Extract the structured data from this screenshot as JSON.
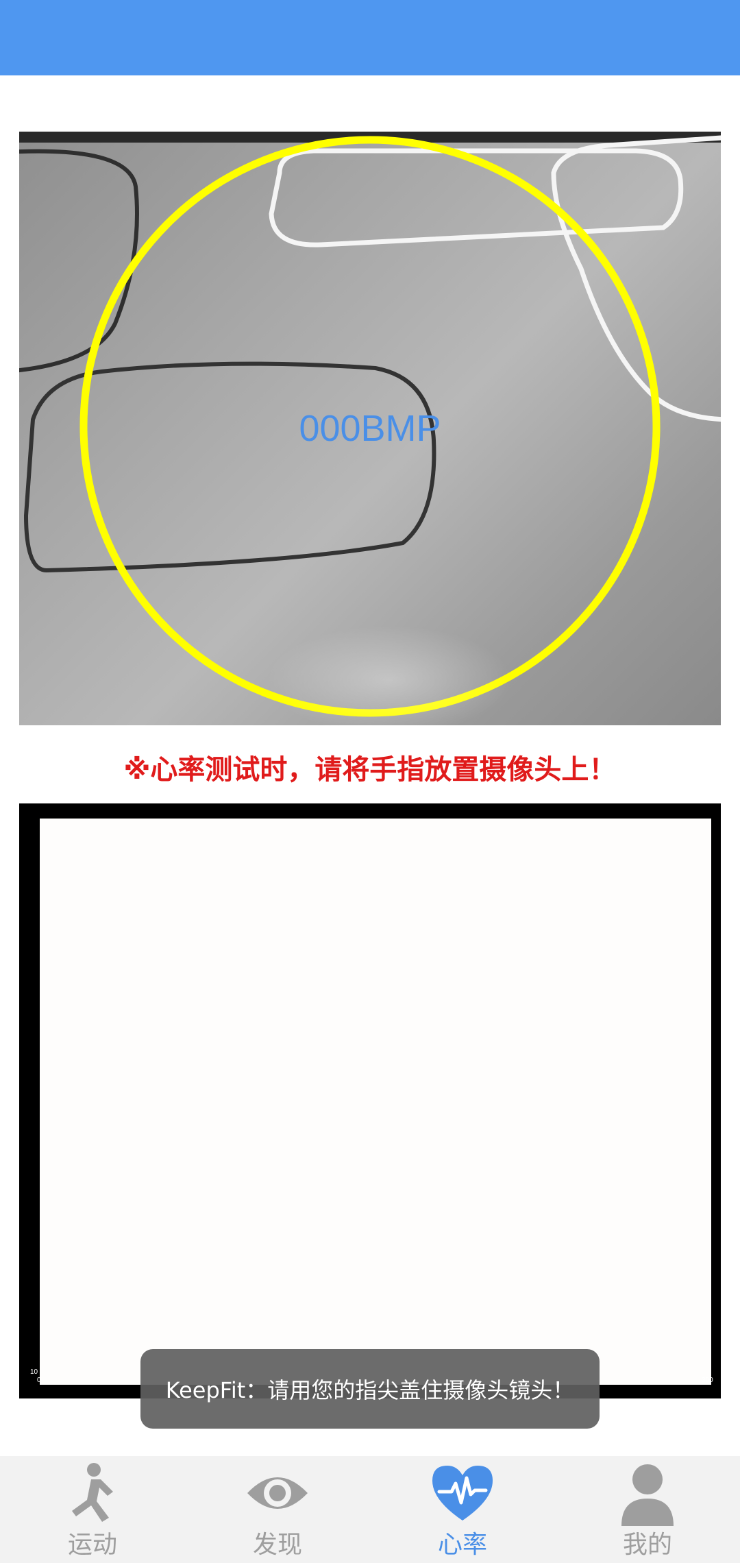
{
  "camera": {
    "bpm_value": "000BMP",
    "ring_color": "#FFFF00",
    "bpm_color": "#4A8FE7"
  },
  "warning": {
    "text": "※心率测试时，请将手指放置摄像头上！",
    "color": "#E01B1B"
  },
  "chart": {
    "y_tick_top": "10",
    "y_tick_bottom": "0",
    "x_tick_right": "300"
  },
  "toast": {
    "text": "KeepFit：请用您的指尖盖住摄像头镜头！"
  },
  "bottom_nav": {
    "accent": "#4A8FE7",
    "items": [
      {
        "label": "运动",
        "icon": "running-icon"
      },
      {
        "label": "发现",
        "icon": "eye-icon"
      },
      {
        "label": "心率",
        "icon": "heart-rate-icon"
      },
      {
        "label": "我的",
        "icon": "user-icon"
      }
    ]
  }
}
